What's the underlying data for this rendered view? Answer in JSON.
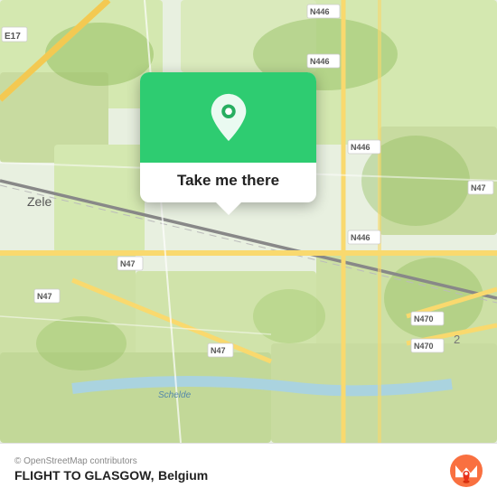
{
  "map": {
    "background_color": "#e8f0e0",
    "city_label": "Zele",
    "road_labels": [
      "E17",
      "N47",
      "N47",
      "N47",
      "N446",
      "N446",
      "N446",
      "N446",
      "N470",
      "N470"
    ],
    "water_label": "Schelde"
  },
  "popup": {
    "button_label": "Take me there",
    "icon_bg_color": "#27ae60"
  },
  "bottom_bar": {
    "copyright": "© OpenStreetMap contributors",
    "title": "FLIGHT TO GLASGOW,",
    "country": "Belgium"
  }
}
